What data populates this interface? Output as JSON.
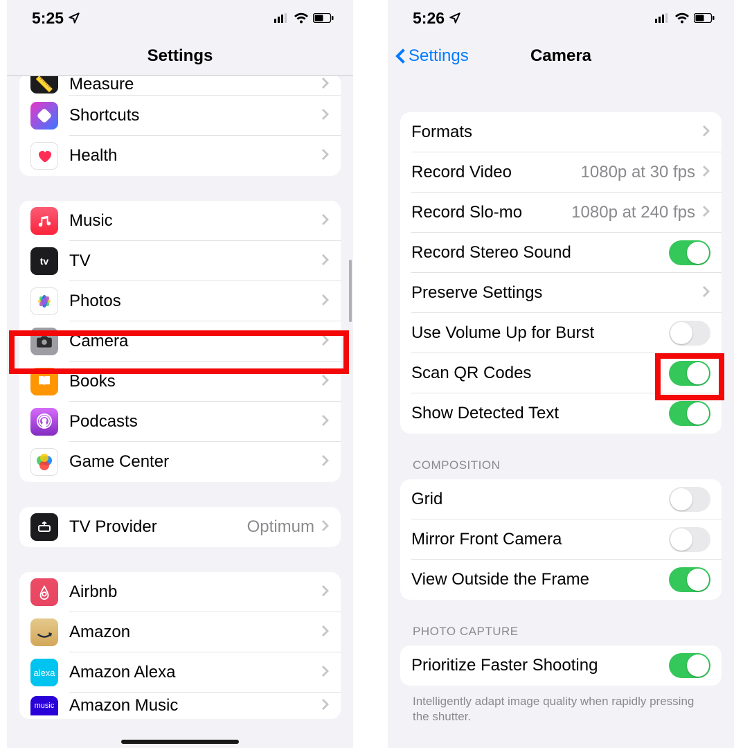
{
  "left": {
    "status_time": "5:25",
    "title": "Settings",
    "group1": {
      "items": [
        {
          "label": "Measure",
          "icon_bg": "#1c1c1e",
          "icon_name": "measure-icon"
        },
        {
          "label": "Shortcuts",
          "icon_bg": "#3a3042",
          "icon_name": "shortcuts-icon"
        },
        {
          "label": "Health",
          "icon_bg": "#ffffff",
          "icon_name": "health-icon"
        }
      ]
    },
    "group2": {
      "items": [
        {
          "label": "Music",
          "icon_bg": "#fc3158",
          "icon_name": "music-icon"
        },
        {
          "label": "TV",
          "icon_bg": "#1c1c1e",
          "icon_name": "tv-icon"
        },
        {
          "label": "Photos",
          "icon_bg": "#ffffff",
          "icon_name": "photos-icon"
        },
        {
          "label": "Camera",
          "icon_bg": "#a0a0a5",
          "icon_name": "camera-icon"
        },
        {
          "label": "Books",
          "icon_bg": "#ff9500",
          "icon_name": "books-icon"
        },
        {
          "label": "Podcasts",
          "icon_bg": "#a050de",
          "icon_name": "podcasts-icon"
        },
        {
          "label": "Game Center",
          "icon_bg": "#ffffff",
          "icon_name": "game-center-icon"
        }
      ]
    },
    "group3": {
      "items": [
        {
          "label": "TV Provider",
          "value": "Optimum",
          "icon_bg": "#1c1c1e",
          "icon_name": "tv-provider-icon"
        }
      ]
    },
    "group4": {
      "items": [
        {
          "label": "Airbnb",
          "icon_bg": "#ff385c",
          "icon_name": "airbnb-icon"
        },
        {
          "label": "Amazon",
          "icon_bg": "#f0c14b",
          "icon_name": "amazon-icon"
        },
        {
          "label": "Amazon Alexa",
          "icon_bg": "#00caff",
          "icon_name": "alexa-icon"
        },
        {
          "label": "Amazon Music",
          "icon_bg": "#3a00ff",
          "icon_name": "amazon-music-icon"
        }
      ]
    }
  },
  "right": {
    "status_time": "5:26",
    "back_label": "Settings",
    "title": "Camera",
    "group1": {
      "items": [
        {
          "type": "nav",
          "label": "Formats"
        },
        {
          "type": "nav",
          "label": "Record Video",
          "value": "1080p at 30 fps"
        },
        {
          "type": "nav",
          "label": "Record Slo-mo",
          "value": "1080p at 240 fps"
        },
        {
          "type": "toggle",
          "label": "Record Stereo Sound",
          "on": true
        },
        {
          "type": "nav",
          "label": "Preserve Settings"
        },
        {
          "type": "toggle",
          "label": "Use Volume Up for Burst",
          "on": false
        },
        {
          "type": "toggle",
          "label": "Scan QR Codes",
          "on": true
        },
        {
          "type": "toggle",
          "label": "Show Detected Text",
          "on": true
        }
      ]
    },
    "group2": {
      "header": "COMPOSITION",
      "items": [
        {
          "type": "toggle",
          "label": "Grid",
          "on": false
        },
        {
          "type": "toggle",
          "label": "Mirror Front Camera",
          "on": false
        },
        {
          "type": "toggle",
          "label": "View Outside the Frame",
          "on": true
        }
      ]
    },
    "group3": {
      "header": "PHOTO CAPTURE",
      "items": [
        {
          "type": "toggle",
          "label": "Prioritize Faster Shooting",
          "on": true
        }
      ],
      "footer": "Intelligently adapt image quality when rapidly pressing the shutter."
    }
  }
}
